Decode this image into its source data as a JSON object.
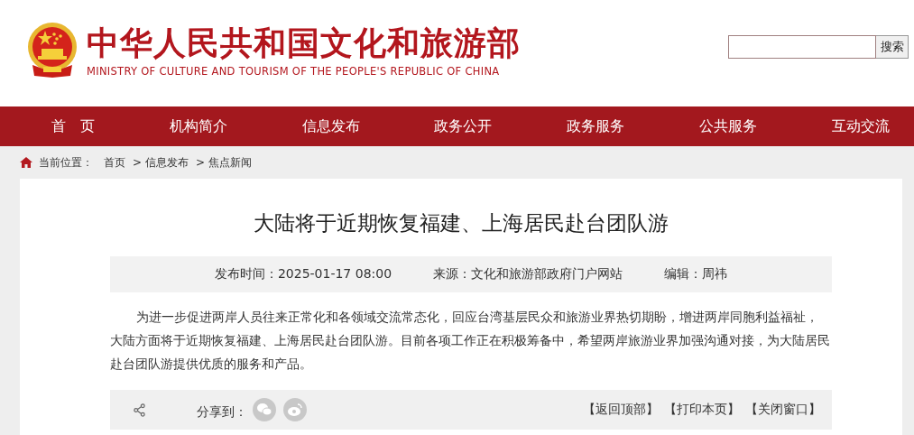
{
  "header": {
    "title": "中华人民共和国文化和旅游部",
    "subtitle": "MINISTRY OF CULTURE AND TOURISM OF THE PEOPLE'S REPUBLIC OF CHINA",
    "search_button": "搜索"
  },
  "nav": [
    "首　页",
    "机构简介",
    "信息发布",
    "政务公开",
    "政务服务",
    "公共服务",
    "互动交流"
  ],
  "breadcrumb": {
    "label": "当前位置：",
    "items": [
      "首页",
      "> 信息发布",
      "> 焦点新闻"
    ]
  },
  "article": {
    "title": "大陆将于近期恢复福建、上海居民赴台团队游",
    "meta": [
      "发布时间：2025-01-17 08:00",
      "来源：文化和旅游部政府门户网站",
      "编辑：周祎"
    ],
    "body": "为进一步促进两岸人员往来正常化和各领域交流常态化，回应台湾基层民众和旅游业界热切期盼，增进两岸同胞利益福祉，大陆方面将于近期恢复福建、上海居民赴台团队游。目前各项工作正在积极筹备中，希望两岸旅游业界加强沟通对接，为大陆居民赴台团队游提供优质的服务和产品。",
    "share_label": "分享到：",
    "actions": [
      "【返回顶部】",
      "【打印本页】",
      "【关闭窗口】"
    ]
  }
}
